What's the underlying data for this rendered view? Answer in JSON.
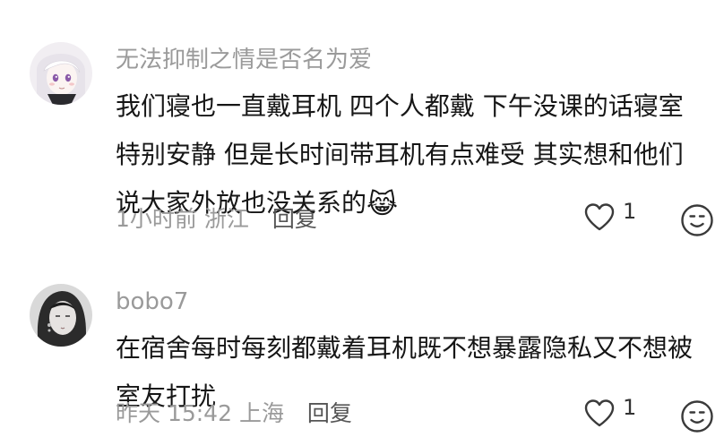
{
  "comments": [
    {
      "username": "无法抑制之情是否名为爱",
      "text": "我们寝也一直戴耳机 四个人都戴 下午没课的话寝室特别安静 但是长时间带耳机有点难受 其实想和他们说大家外放也没关系的",
      "emoji": "😹",
      "time": "1小时前",
      "location": "浙江",
      "reply_label": "回复",
      "likes": "1"
    },
    {
      "username": "bobo7",
      "text": "在宿舍每时每刻都戴着耳机既不想暴露隐私又不想被室友打扰",
      "time": "昨天 15:42",
      "location": "上海",
      "reply_label": "回复",
      "likes": "1"
    }
  ],
  "icons": {
    "like": "heart-outline-icon",
    "emoji_reaction": "smiley-face-icon"
  }
}
